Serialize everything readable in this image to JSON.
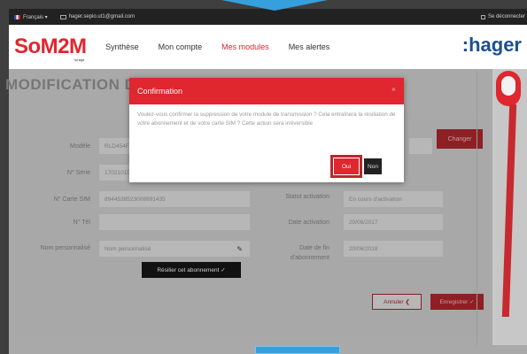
{
  "topbar": {
    "language": "Français ▾",
    "email": "hager.sepio.ut1@gmail.com",
    "logout": "Se déconnecter"
  },
  "logo": {
    "brand_so": "So",
    "brand_m2m": "M2M",
    "brand_by": "by hager"
  },
  "nav": {
    "items": [
      {
        "label": "Synthèse",
        "active": false
      },
      {
        "label": "Mon compte",
        "active": false
      },
      {
        "label": "Mes modules",
        "active": true
      },
      {
        "label": "Mes alertes",
        "active": false
      }
    ]
  },
  "hager_logo": ":hager",
  "page": {
    "title": "MODIFICATION D",
    "labels": {
      "modele": "Modèle",
      "serie": "N° Série",
      "sim": "N° Carte SIM",
      "tel": "N° Tél",
      "nom": "Nom personnalisé",
      "statut": "Statut activation",
      "date_activation": "Date activation",
      "date_fin": "Date de fin d'abonnement"
    },
    "values": {
      "modele": "RLD454F S",
      "serie": "1702101DC",
      "sim": "8944538523008991435",
      "tel": "",
      "nom_placeholder": "Nom personnalisé",
      "statut": "En cours d'activation",
      "date_activation": "20/06/2017",
      "date_fin": "20/06/2018"
    },
    "buttons": {
      "change": "Changer",
      "resilier": "Résilier cet abonnement ✓",
      "cancel": "Annuler ❮",
      "save": "Enregistrer ✓"
    }
  },
  "dialog": {
    "title": "Confirmation",
    "close": "×",
    "message": "Voulez-vous confirmer la suppression de votre module de transmission ? Cela entraînera la résiliation de votre abonnement et de votre carte SIM ? Cette action sera irréversible",
    "yes": "Oui",
    "no": "Non"
  }
}
